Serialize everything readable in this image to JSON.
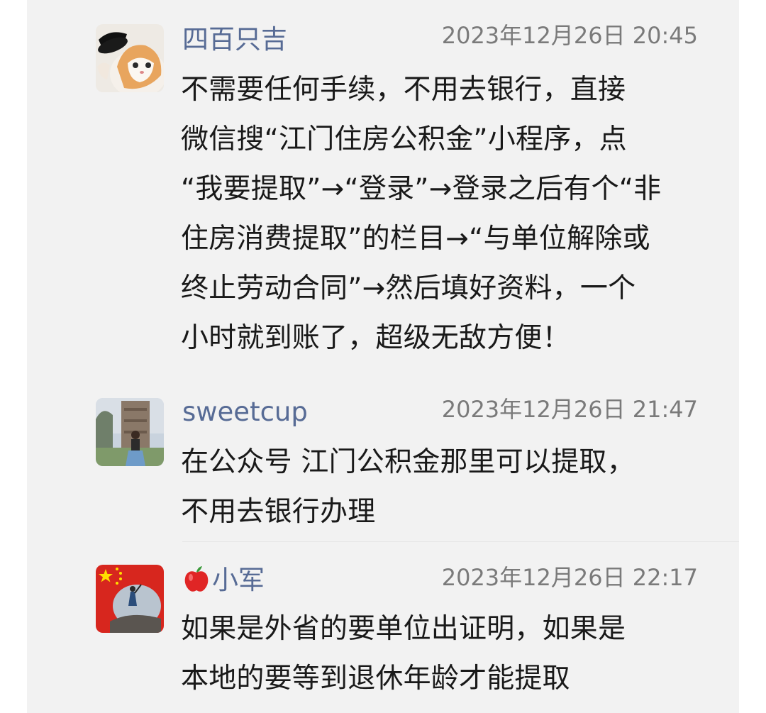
{
  "comments": [
    {
      "username": "四百只吉",
      "timestamp": "2023年12月26日 20:45",
      "avatar_icon": "cat-with-hat-avatar",
      "lines": [
        "不需要任何手续，不用去银行，直接",
        "微信搜“江门住房公积金”小程序，点",
        "“我要提取”→“登录”→登录之后有个“非",
        "住房消费提取”的栏目→“与单位解除或",
        "终止劳动合同”→然后填好资料，一个",
        "小时就到账了，超级无敌方便！"
      ]
    },
    {
      "username": "sweetcup",
      "timestamp": "2023年12月26日 21:47",
      "avatar_icon": "person-at-tower-avatar",
      "lines": [
        "在公众号 江门公积金那里可以提取，",
        "不用去银行办理"
      ]
    },
    {
      "username_emoji": "apple-icon",
      "username": "小军",
      "timestamp": "2023年12月26日 22:17",
      "avatar_icon": "china-flag-person-avatar",
      "lines": [
        "如果是外省的要单位出证明，如果是",
        "本地的要等到退休年龄才能提取"
      ]
    }
  ],
  "colors": {
    "username": "#576b95",
    "timestamp": "#7a7a7a",
    "text": "#191919",
    "card_background": "#f2f2f2",
    "page_background": "#ffffff"
  }
}
